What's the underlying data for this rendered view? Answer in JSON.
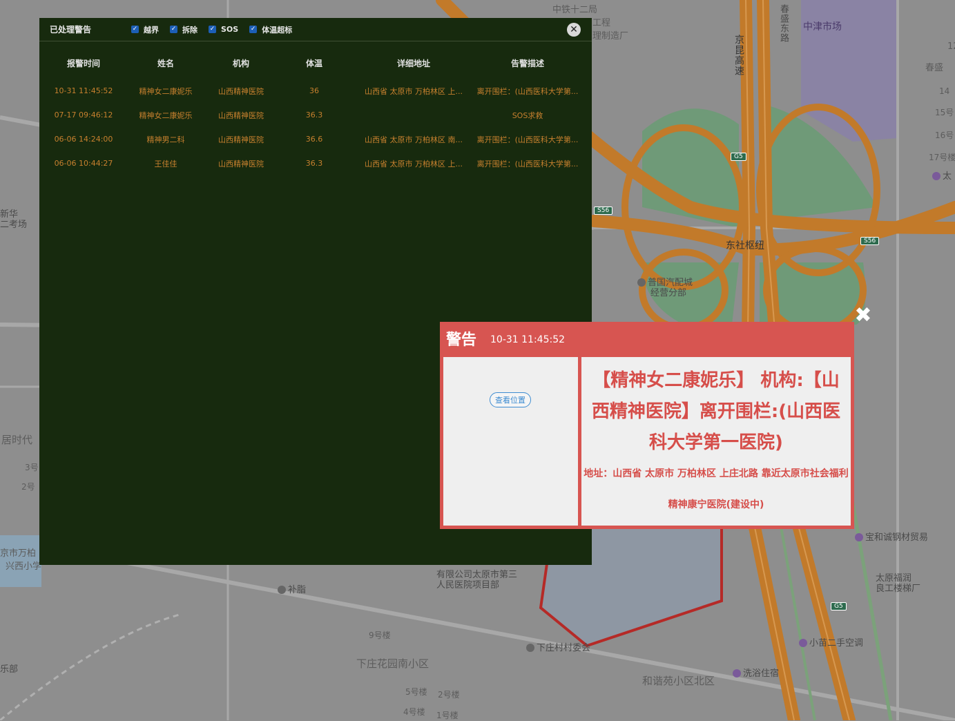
{
  "map": {
    "labels": {
      "l1": "中铁十二局",
      "l2": "工程",
      "l3": "理制造厂",
      "l4": "中津市场",
      "l5": "春盛东路",
      "l6": "京昆高速",
      "l7": "春盛",
      "l8": "14",
      "l9": "15号",
      "l10": "16号",
      "l11": "17号楼",
      "l12": "太",
      "l13": "东社枢纽",
      "l14": "普国汽配城",
      "l15": "经营分部",
      "l16": "新华",
      "l17": "二考场",
      "l18": "居时代",
      "l19": "3号",
      "l20": "2号",
      "l21": "京市万柏",
      "l22": "兴西小学",
      "l23": "补脂",
      "l24": "有限公司太原市第三",
      "l25": "人民医院项目部",
      "l26": "9号楼",
      "l27": "下庄花园南小区",
      "l28": "5号楼",
      "l29": "2号楼",
      "l30": "4号楼",
      "l31": "1号楼",
      "l32": "下庄村村委会",
      "l33": "和谐苑小区北区",
      "l34": "洗浴住宿",
      "l35": "宝和诚钢材贸易",
      "l36": "太原福润",
      "l37": "良工楼梯厂",
      "l38": "小苗二手空调",
      "l39": "乐部",
      "l40": "12"
    },
    "shields": {
      "g5a": "G5",
      "s56a": "S56",
      "s56b": "S56",
      "g5b": "G5"
    }
  },
  "alarm_panel": {
    "title": "已处理警告",
    "filters": [
      {
        "label": "越界",
        "checked": true
      },
      {
        "label": "拆除",
        "checked": true
      },
      {
        "label": "SOS",
        "checked": true
      },
      {
        "label": "体温超标",
        "checked": true
      }
    ],
    "close_icon": "close-circle-icon",
    "columns": [
      "报警时间",
      "姓名",
      "机构",
      "体温",
      "详细地址",
      "告警描述"
    ],
    "rows": [
      {
        "time": "10-31 11:45:52",
        "name": "精神女二康妮乐",
        "org": "山西精神医院",
        "temp": "36",
        "addr": "山西省 太原市 万柏林区 上...",
        "desc": "离开围栏：(山西医科大学第..."
      },
      {
        "time": "07-17 09:46:12",
        "name": "精神女二康妮乐",
        "org": "山西精神医院",
        "temp": "36.3",
        "addr": "",
        "desc": "SOS求救"
      },
      {
        "time": "06-06 14:24:00",
        "name": "精神男二科",
        "org": "山西精神医院",
        "temp": "36.6",
        "addr": "山西省 太原市 万柏林区 南...",
        "desc": "离开围栏：(山西医科大学第..."
      },
      {
        "time": "06-06 10:44:27",
        "name": "王佳佳",
        "org": "山西精神医院",
        "temp": "36.3",
        "addr": "山西省 太原市 万柏林区 上...",
        "desc": "离开围栏：(山西医科大学第..."
      }
    ]
  },
  "warning_popup": {
    "title": "警告",
    "time": "10-31 11:45:52",
    "locate_button": "查看位置",
    "message": "【精神女二康妮乐】 机构:【山西精神医院】离开围栏:(山西医科大学第一医院)",
    "address": "地址：山西省 太原市 万柏林区 上庄北路 靠近太原市社会福利精神康宁医院(建设中)",
    "close_icon": "close-x-icon"
  },
  "colors": {
    "panel_bg": "#172a0e",
    "row_text": "#c7802e",
    "popup_accent": "#d75551",
    "checkbox": "#1d5fb6"
  }
}
